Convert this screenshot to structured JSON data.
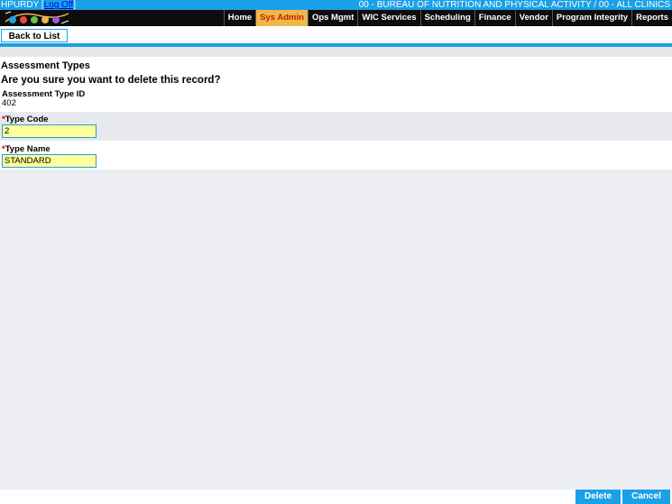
{
  "header": {
    "user": "HPURDY",
    "logoff_label": "Log Off",
    "clinic": "00 - BUREAU OF NUTRITION AND PHYSICAL ACTIVITY / 00 - ALL CLINICS"
  },
  "logo": {
    "name": "app-logo",
    "text": "B N Q D S"
  },
  "nav": {
    "items": [
      {
        "label": "Home"
      },
      {
        "label": "Sys Admin",
        "active": true
      },
      {
        "label": "Ops Mgmt"
      },
      {
        "label": "WIC Services"
      },
      {
        "label": "Scheduling"
      },
      {
        "label": "Finance"
      },
      {
        "label": "Vendor"
      },
      {
        "label": "Program Integrity"
      },
      {
        "label": "Reports"
      }
    ]
  },
  "toolbar": {
    "back_label": "Back to List"
  },
  "page": {
    "title": "Assessment Types",
    "confirm": "Are you sure you want to delete this record?",
    "id_label": "Assessment Type ID",
    "id_value": "402"
  },
  "fields": {
    "type_code": {
      "required_mark": "*",
      "label": "Type Code",
      "value": "2"
    },
    "type_name": {
      "required_mark": "*",
      "label": "Type Name",
      "value": "STANDARD"
    }
  },
  "footer": {
    "delete_label": "Delete",
    "cancel_label": "Cancel"
  },
  "colors": {
    "accent": "#1aa0e6",
    "active_tab_bg": "#f0b84a",
    "active_tab_text": "#c02000",
    "field_bg": "#ffff99"
  }
}
